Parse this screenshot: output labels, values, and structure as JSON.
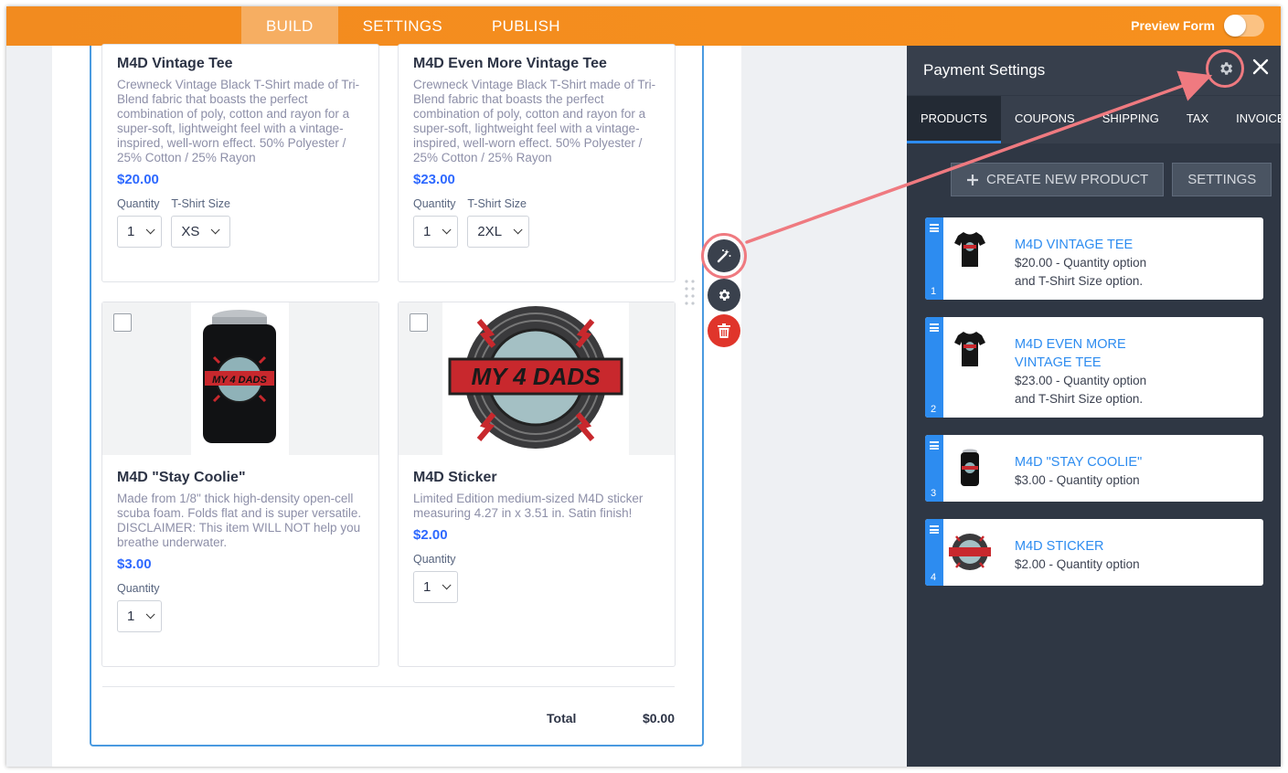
{
  "topbar": {
    "tabs": [
      {
        "label": "BUILD",
        "active": true
      },
      {
        "label": "SETTINGS",
        "active": false
      },
      {
        "label": "PUBLISH",
        "active": false
      }
    ],
    "preview_label": "Preview Form",
    "preview_on": false
  },
  "form": {
    "products": [
      {
        "title": "M4D Vintage Tee",
        "description": "Crewneck Vintage Black T-Shirt made of Tri-Blend fabric that boasts the perfect combination of poly, cotton and rayon for a super-soft, lightweight feel with a vintage-inspired, well-worn effect. 50% Polyester / 25% Cotton / 25% Rayon",
        "price": "$20.00",
        "qty_label": "Quantity",
        "qty_value": "1",
        "size_label": "T-Shirt Size",
        "size_value": "XS"
      },
      {
        "title": "M4D Even More Vintage Tee",
        "description": "Crewneck Vintage Black T-Shirt made of Tri-Blend fabric that boasts the perfect combination of poly, cotton and rayon for a super-soft, lightweight feel with a vintage-inspired, well-worn effect. 50% Polyester / 25% Cotton / 25% Rayon",
        "price": "$23.00",
        "qty_label": "Quantity",
        "qty_value": "1",
        "size_label": "T-Shirt Size",
        "size_value": "2XL"
      },
      {
        "title": "M4D \"Stay Coolie\"",
        "description": "Made from 1/8\" thick high-density open-cell scuba foam. Folds flat and is super versatile. DISCLAIMER: This item WILL NOT help you breathe underwater.",
        "price": "$3.00",
        "qty_label": "Quantity",
        "qty_value": "1"
      },
      {
        "title": "M4D Sticker",
        "description": "Limited Edition medium-sized M4D sticker measuring 4.27 in x 3.51 in. Satin finish!",
        "price": "$2.00",
        "qty_label": "Quantity",
        "qty_value": "1"
      }
    ],
    "logo_text": "MY 4 DADS",
    "total_label": "Total",
    "total_value": "$0.00"
  },
  "panel": {
    "title": "Payment Settings",
    "tabs": [
      {
        "label": "PRODUCTS",
        "active": true
      },
      {
        "label": "COUPONS",
        "active": false
      },
      {
        "label": "SHIPPING",
        "active": false
      },
      {
        "label": "TAX",
        "active": false
      },
      {
        "label": "INVOICE",
        "active": false
      }
    ],
    "create_label": "CREATE NEW PRODUCT",
    "settings_label": "SETTINGS",
    "items": [
      {
        "num": "1",
        "name": "M4D VINTAGE TEE",
        "desc": "$20.00 - Quantity option and T-Shirt Size option.",
        "thumb": "tshirt"
      },
      {
        "num": "2",
        "name": "M4D EVEN MORE VINTAGE TEE",
        "desc": "$23.00 - Quantity option and T-Shirt Size option.",
        "thumb": "tshirt"
      },
      {
        "num": "3",
        "name": "M4D \"STAY COOLIE\"",
        "desc": "$3.00 - Quantity option",
        "thumb": "koozie"
      },
      {
        "num": "4",
        "name": "M4D STICKER",
        "desc": "$2.00 - Quantity option",
        "thumb": "sticker"
      }
    ]
  },
  "colors": {
    "brand_orange": "#f7901e",
    "accent_blue": "#2d8cf0",
    "price_blue": "#2e69ff",
    "panel_bg": "#2f3744",
    "callout": "#ef7a80",
    "delete_red": "#e0352b"
  },
  "icons": [
    "gear-icon",
    "close-icon",
    "wand-icon",
    "trash-icon",
    "plus-icon",
    "drag-handle-icon",
    "chevron-down-icon"
  ]
}
